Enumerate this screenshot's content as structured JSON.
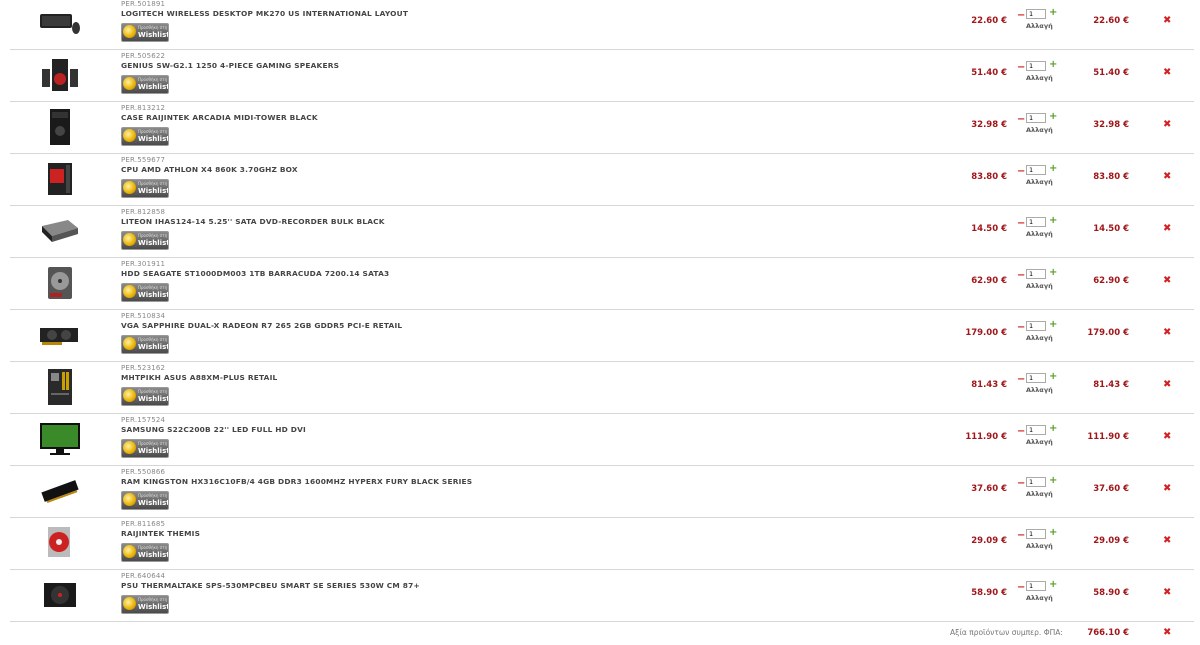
{
  "cart": {
    "wishlist_small": "Προσθήκη στη",
    "wishlist_label": "Wishlist",
    "change_label": "Αλλαγή",
    "remove_symbol": "✖",
    "minus_symbol": "−",
    "plus_symbol": "+",
    "items": [
      {
        "code": "PER.501891",
        "name": "LOGITECH WIRELESS DESKTOP MK270 US INTERNATIONAL LAYOUT",
        "price": "22.60 €",
        "qty": "1",
        "total": "22.60 €",
        "icon": "keyboard-icon"
      },
      {
        "code": "PER.505622",
        "name": "GENIUS SW-G2.1 1250 4-PIECE GAMING SPEAKERS",
        "price": "51.40 €",
        "qty": "1",
        "total": "51.40 €",
        "icon": "speakers-icon"
      },
      {
        "code": "PER.813212",
        "name": "CASE RAIJINTEK ARCADIA MIDI-TOWER BLACK",
        "price": "32.98 €",
        "qty": "1",
        "total": "32.98 €",
        "icon": "pc-case-icon"
      },
      {
        "code": "PER.559677",
        "name": "CPU AMD ATHLON X4 860K 3.70GHZ BOX",
        "price": "83.80 €",
        "qty": "1",
        "total": "83.80 €",
        "icon": "cpu-box-icon"
      },
      {
        "code": "PER.812858",
        "name": "LITEON IHAS124-14 5.25'' SATA DVD-RECORDER BULK BLACK",
        "price": "14.50 €",
        "qty": "1",
        "total": "14.50 €",
        "icon": "dvd-drive-icon"
      },
      {
        "code": "PER.301911",
        "name": "HDD SEAGATE ST1000DM003 1TB BARRACUDA 7200.14 SATA3",
        "price": "62.90 €",
        "qty": "1",
        "total": "62.90 €",
        "icon": "hard-drive-icon"
      },
      {
        "code": "PER.510834",
        "name": "VGA SAPPHIRE DUAL-X RADEON R7 265 2GB GDDR5 PCI-E RETAIL",
        "price": "179.00 €",
        "qty": "1",
        "total": "179.00 €",
        "icon": "graphics-card-icon"
      },
      {
        "code": "PER.523162",
        "name": "ΜΗΤΡΙΚΗ ASUS A88XM-PLUS RETAIL",
        "price": "81.43 €",
        "qty": "1",
        "total": "81.43 €",
        "icon": "motherboard-icon"
      },
      {
        "code": "PER.157524",
        "name": "SAMSUNG S22C200B 22'' LED FULL HD DVI",
        "price": "111.90 €",
        "qty": "1",
        "total": "111.90 €",
        "icon": "monitor-icon"
      },
      {
        "code": "PER.550866",
        "name": "RAM KINGSTON HX316C10FB/4 4GB DDR3 1600MHZ HYPERX FURY BLACK SERIES",
        "price": "37.60 €",
        "qty": "1",
        "total": "37.60 €",
        "icon": "ram-stick-icon"
      },
      {
        "code": "PER.811685",
        "name": "RAIJINTEK THEMIS",
        "price": "29.09 €",
        "qty": "1",
        "total": "29.09 €",
        "icon": "cpu-cooler-icon"
      },
      {
        "code": "PER.640644",
        "name": "PSU THERMALTAKE SPS-530MPCBEU SMART SE SERIES 530W CM 87+",
        "price": "58.90 €",
        "qty": "1",
        "total": "58.90 €",
        "icon": "power-supply-icon"
      }
    ]
  },
  "summary": {
    "label": "Αξία προϊόντων συμπερ. ΦΠΑ:",
    "value": "766.10 €"
  }
}
